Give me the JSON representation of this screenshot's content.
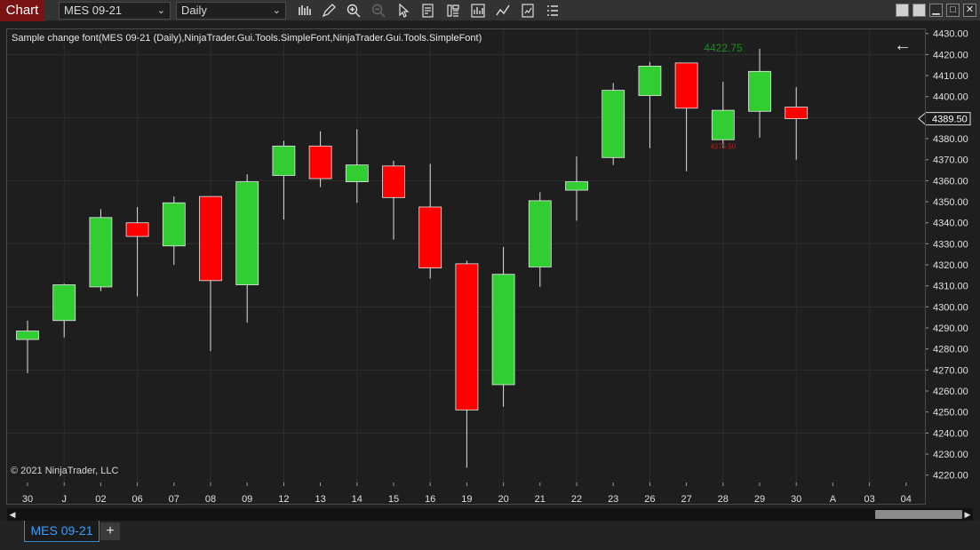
{
  "toolbar": {
    "title": "Chart",
    "instrument": "MES 09-21",
    "interval": "Daily",
    "icons": [
      "bar-type-icon",
      "draw-tool-icon",
      "zoom-in-icon",
      "zoom-out-icon",
      "pointer-icon",
      "data-box-icon",
      "properties-icon",
      "chart-trader-icon",
      "indicators-icon",
      "strategies-icon",
      "templates-icon"
    ]
  },
  "window": {
    "minimize": "▁",
    "maximize": "□",
    "close": "✕"
  },
  "chart": {
    "label": "Sample change font(MES 09-21 (Daily),NinjaTrader.Gui.Tools.SimpleFont,NinjaTrader.Gui.Tools.SimpleFont)",
    "copyright": "© 2021 NinjaTrader, LLC"
  },
  "chart_data": {
    "type": "candlestick",
    "x_labels": [
      "30",
      "J",
      "02",
      "06",
      "07",
      "08",
      "09",
      "12",
      "13",
      "14",
      "15",
      "16",
      "19",
      "20",
      "21",
      "22",
      "23",
      "26",
      "27",
      "28",
      "29",
      "30",
      "A",
      "03",
      "04"
    ],
    "candles": [
      {
        "open": 4284.5,
        "high": 4293.5,
        "low": 4268.5,
        "close": 4288.5
      },
      {
        "open": 4293.5,
        "high": 4311.0,
        "low": 4285.5,
        "close": 4310.5
      },
      {
        "open": 4309.5,
        "high": 4346.5,
        "low": 4307.5,
        "close": 4342.5
      },
      {
        "open": 4340.0,
        "high": 4347.5,
        "low": 4305.0,
        "close": 4333.5
      },
      {
        "open": 4329.0,
        "high": 4352.5,
        "low": 4320.0,
        "close": 4349.5
      },
      {
        "open": 4352.5,
        "high": 4352.5,
        "low": 4279.0,
        "close": 4312.5
      },
      {
        "open": 4310.5,
        "high": 4363.0,
        "low": 4292.5,
        "close": 4359.5
      },
      {
        "open": 4362.5,
        "high": 4379.0,
        "low": 4341.5,
        "close": 4376.5
      },
      {
        "open": 4376.5,
        "high": 4383.5,
        "low": 4357.0,
        "close": 4361.0
      },
      {
        "open": 4359.5,
        "high": 4384.5,
        "low": 4349.5,
        "close": 4367.5
      },
      {
        "open": 4367.0,
        "high": 4369.5,
        "low": 4332.0,
        "close": 4352.0
      },
      {
        "open": 4347.5,
        "high": 4368.0,
        "low": 4313.5,
        "close": 4318.5
      },
      {
        "open": 4320.5,
        "high": 4322.0,
        "low": 4223.5,
        "close": 4251.0
      },
      {
        "open": 4263.0,
        "high": 4328.5,
        "low": 4252.5,
        "close": 4315.5
      },
      {
        "open": 4319.0,
        "high": 4354.5,
        "low": 4309.5,
        "close": 4350.5
      },
      {
        "open": 4355.5,
        "high": 4371.5,
        "low": 4341.0,
        "close": 4359.5
      },
      {
        "open": 4371.0,
        "high": 4406.5,
        "low": 4367.5,
        "close": 4403.0
      },
      {
        "open": 4400.5,
        "high": 4416.5,
        "low": 4375.5,
        "close": 4414.5
      },
      {
        "open": 4416.0,
        "high": 4416.0,
        "low": 4364.5,
        "close": 4394.5
      },
      {
        "open": 4379.5,
        "high": 4407.0,
        "low": 4375.5,
        "close": 4393.5
      },
      {
        "open": 4393.0,
        "high": 4422.75,
        "low": 4380.5,
        "close": 4412.0
      },
      {
        "open": 4395.0,
        "high": 4404.5,
        "low": 4370.0,
        "close": 4389.5
      }
    ],
    "y_ticks": [
      "4220.00",
      "4230.00",
      "4240.00",
      "4250.00",
      "4260.00",
      "4270.00",
      "4280.00",
      "4290.00",
      "4300.00",
      "4310.00",
      "4320.00",
      "4330.00",
      "4340.00",
      "4350.00",
      "4360.00",
      "4370.00",
      "4380.00",
      "4390.00",
      "4400.00",
      "4410.00",
      "4420.00",
      "4430.00"
    ],
    "ylim": [
      4216.5,
      4432.0
    ],
    "last_price": "4389.50",
    "high_marker": "4422.75",
    "low_marker": "4375.50",
    "colors": {
      "up": "#32cd32",
      "down": "#ff0000",
      "wick": "#e0e0e0",
      "grid": "#2e2e2e",
      "background": "#1e1e1e",
      "high_marker": "#1e8c1e",
      "low_marker": "#b22222"
    },
    "grid": true
  },
  "tabs": [
    {
      "label": "MES 09-21"
    }
  ],
  "tab_add": "+"
}
